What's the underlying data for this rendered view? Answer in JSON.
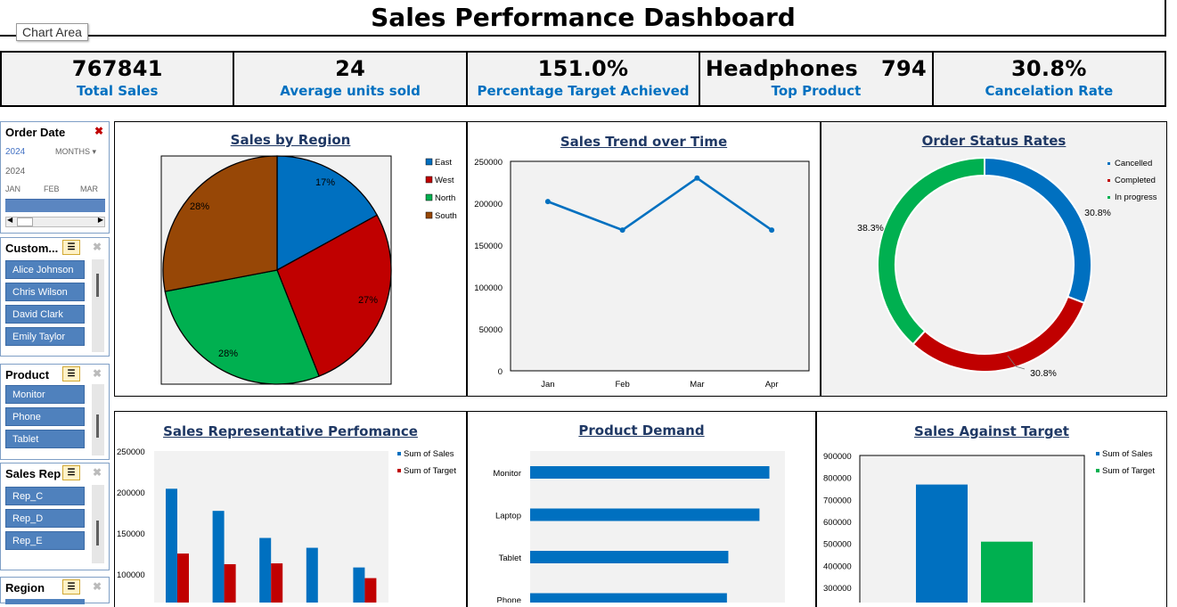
{
  "title": "Sales Performance Dashboard",
  "tooltip": "Chart Area",
  "kpis": [
    {
      "value": "767841",
      "label": "Total Sales"
    },
    {
      "value": "24",
      "label": "Average units sold"
    },
    {
      "value": "151.0%",
      "label": "Percentage Target Achieved"
    },
    {
      "value": "Headphones   794",
      "label": "Top Product"
    },
    {
      "value": "30.8%",
      "label": "Cancelation Rate"
    }
  ],
  "timeline": {
    "title": "Order Date",
    "year": "2024",
    "level": "MONTHS",
    "year_label": "2024",
    "months": [
      "JAN",
      "FEB",
      "MAR"
    ]
  },
  "slicers": {
    "customer": {
      "title": "Custom...",
      "items": [
        "Alice Johnson",
        "Chris Wilson",
        "David Clark",
        "Emily Taylor"
      ]
    },
    "product": {
      "title": "Product",
      "items": [
        "Monitor",
        "Phone",
        "Tablet"
      ]
    },
    "sales_rep": {
      "title": "Sales Rep",
      "items": [
        "Rep_C",
        "Rep_D",
        "Rep_E"
      ]
    },
    "region": {
      "title": "Region",
      "items": []
    }
  },
  "colors": {
    "blue": "#0070c0",
    "red": "#c00000",
    "green": "#00b050",
    "brown": "#974706",
    "title_navy": "#1f3864"
  },
  "chart_data": [
    {
      "id": "sales_by_region",
      "type": "pie",
      "title": "Sales by Region",
      "categories": [
        "East",
        "West",
        "North",
        "South"
      ],
      "values": [
        17,
        27,
        28,
        28
      ],
      "labels": [
        "17%",
        "27%",
        "28%",
        "28%"
      ],
      "legend": "right"
    },
    {
      "id": "sales_trend",
      "type": "line",
      "title": "Sales Trend over Time",
      "categories": [
        "Jan",
        "Feb",
        "Mar",
        "Apr"
      ],
      "values": [
        202000,
        168000,
        230000,
        168000
      ],
      "ylim": [
        0,
        250000
      ],
      "yticks": [
        "0",
        "50000",
        "100000",
        "150000",
        "200000",
        "250000"
      ]
    },
    {
      "id": "order_status",
      "type": "pie",
      "title": "Order Status Rates",
      "categories": [
        "Cancelled",
        "Completed",
        "In progress"
      ],
      "values": [
        30.8,
        30.8,
        38.3
      ],
      "labels": [
        "30.8%",
        "30.8%",
        "38.3%"
      ],
      "legend": "top-right"
    },
    {
      "id": "rep_performance",
      "type": "bar",
      "title": "Sales Representative Perfomance",
      "series": [
        {
          "name": "Sum of Sales",
          "values": [
            204000,
            177000,
            144000,
            132000,
            108000
          ]
        },
        {
          "name": "Sum of Target",
          "values": [
            125000,
            112000,
            113000,
            null,
            95000
          ]
        }
      ],
      "ylim": [
        50000,
        250000
      ],
      "yticks": [
        "100000",
        "150000",
        "200000",
        "250000"
      ],
      "legend": "top-right"
    },
    {
      "id": "product_demand",
      "type": "bar",
      "title": "Product Demand",
      "categories": [
        "Monitor",
        "Laptop",
        "Tablet",
        "Phone"
      ],
      "values": [
        845,
        810,
        700,
        695
      ],
      "xlim": [
        0,
        900
      ]
    },
    {
      "id": "sales_vs_target",
      "type": "bar",
      "title": "Sales Against Target",
      "series": [
        {
          "name": "Sum of Sales",
          "values": [
            767841
          ]
        },
        {
          "name": "Sum of Target",
          "values": [
            508000
          ]
        }
      ],
      "ylim": [
        200000,
        900000
      ],
      "yticks": [
        "300000",
        "400000",
        "500000",
        "600000",
        "700000",
        "800000",
        "900000"
      ],
      "legend": "top-right"
    }
  ]
}
